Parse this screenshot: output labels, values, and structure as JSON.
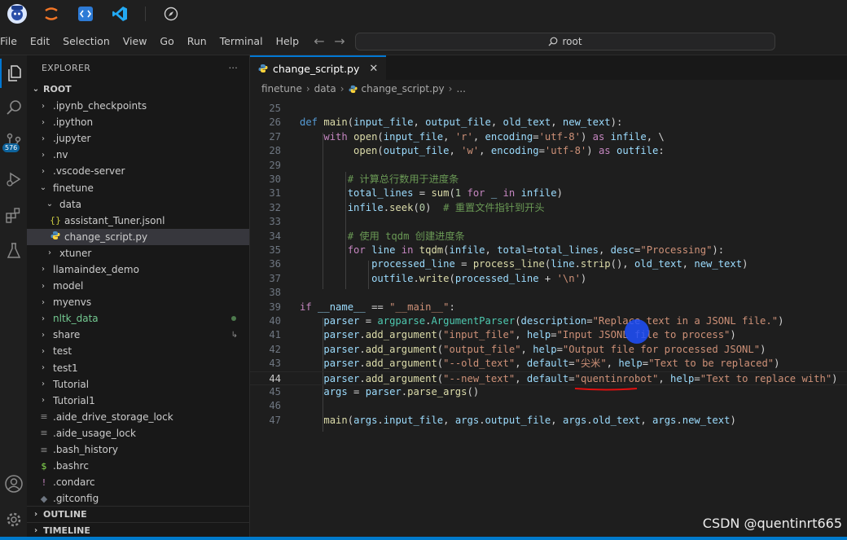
{
  "top_strip": {
    "icons": [
      "pensive-ai-avatar-icon",
      "jupyter-icon",
      "vscode-remote-icon",
      "vscode-icon",
      "compass-icon"
    ]
  },
  "menubar": {
    "items": [
      "File",
      "Edit",
      "Selection",
      "View",
      "Go",
      "Run",
      "Terminal",
      "Help"
    ],
    "search_text": "root"
  },
  "activitybar": {
    "source_control_badge": "576"
  },
  "sidebar": {
    "title": "EXPLORER",
    "more": "···",
    "root_label": "ROOT",
    "tree": [
      {
        "label": ".ipynb_checkpoints",
        "depth": 1,
        "type": "folder",
        "expanded": false
      },
      {
        "label": ".ipython",
        "depth": 1,
        "type": "folder",
        "expanded": false
      },
      {
        "label": ".jupyter",
        "depth": 1,
        "type": "folder",
        "expanded": false
      },
      {
        "label": ".nv",
        "depth": 1,
        "type": "folder",
        "expanded": false
      },
      {
        "label": ".vscode-server",
        "depth": 1,
        "type": "folder",
        "expanded": false
      },
      {
        "label": "finetune",
        "depth": 1,
        "type": "folder",
        "expanded": true
      },
      {
        "label": "data",
        "depth": 2,
        "type": "folder",
        "expanded": true
      },
      {
        "label": "assistant_Tuner.jsonl",
        "depth": 3,
        "type": "json"
      },
      {
        "label": "change_script.py",
        "depth": 3,
        "type": "python",
        "selected": true
      },
      {
        "label": "xtuner",
        "depth": 2,
        "type": "folder",
        "expanded": false
      },
      {
        "label": "llamaindex_demo",
        "depth": 1,
        "type": "folder",
        "expanded": false
      },
      {
        "label": "model",
        "depth": 1,
        "type": "folder",
        "expanded": false
      },
      {
        "label": "myenvs",
        "depth": 1,
        "type": "folder",
        "expanded": false
      },
      {
        "label": "nltk_data",
        "depth": 1,
        "type": "folder",
        "expanded": false,
        "modified": true
      },
      {
        "label": "share",
        "depth": 1,
        "type": "folder",
        "expanded": false,
        "link": true
      },
      {
        "label": "test",
        "depth": 1,
        "type": "folder",
        "expanded": false
      },
      {
        "label": "test1",
        "depth": 1,
        "type": "folder",
        "expanded": false
      },
      {
        "label": "Tutorial",
        "depth": 1,
        "type": "folder",
        "expanded": false
      },
      {
        "label": "Tutorial1",
        "depth": 1,
        "type": "folder",
        "expanded": false
      },
      {
        "label": ".aide_drive_storage_lock",
        "depth": 1,
        "type": "file"
      },
      {
        "label": ".aide_usage_lock",
        "depth": 1,
        "type": "file"
      },
      {
        "label": ".bash_history",
        "depth": 1,
        "type": "file"
      },
      {
        "label": ".bashrc",
        "depth": 1,
        "type": "shell"
      },
      {
        "label": ".condarc",
        "depth": 1,
        "type": "excl"
      },
      {
        "label": ".gitconfig",
        "depth": 1,
        "type": "git"
      }
    ],
    "outline_label": "OUTLINE",
    "timeline_label": "TIMELINE"
  },
  "editor": {
    "tab_label": "change_script.py",
    "tab_close": "✕",
    "breadcrumb": [
      "finetune",
      "data",
      "change_script.py",
      "..."
    ],
    "current_line": 44,
    "lines": [
      {
        "n": "25",
        "html": ""
      },
      {
        "n": "26",
        "html": "<span class='kw'>def</span> <span class='fn'>main</span>(<span class='var'>input_file</span>, <span class='var'>output_file</span>, <span class='var'>old_text</span>, <span class='var'>new_text</span>):"
      },
      {
        "n": "27",
        "html": "    <span class='kw2'>with</span> <span class='fn'>open</span>(<span class='var'>input_file</span>, <span class='str'>'r'</span>, <span class='var'>encoding</span>=<span class='str'>'utf-8'</span>) <span class='kw2'>as</span> <span class='var'>infile</span>, \\"
      },
      {
        "n": "28",
        "html": "         <span class='fn'>open</span>(<span class='var'>output_file</span>, <span class='str'>'w'</span>, <span class='var'>encoding</span>=<span class='str'>'utf-8'</span>) <span class='kw2'>as</span> <span class='var'>outfile</span>:"
      },
      {
        "n": "29",
        "html": ""
      },
      {
        "n": "30",
        "html": "        <span class='cm'># 计算总行数用于进度条</span>"
      },
      {
        "n": "31",
        "html": "        <span class='var'>total_lines</span> = <span class='fn'>sum</span>(<span class='num'>1</span> <span class='kw2'>for</span> <span class='var'>_</span> <span class='kw2'>in</span> <span class='var'>infile</span>)"
      },
      {
        "n": "32",
        "html": "        <span class='var'>infile</span>.<span class='fn'>seek</span>(<span class='num'>0</span>)  <span class='cm'># 重置文件指针到开头</span>"
      },
      {
        "n": "33",
        "html": ""
      },
      {
        "n": "34",
        "html": "        <span class='cm'># 使用 tqdm 创建进度条</span>"
      },
      {
        "n": "35",
        "html": "        <span class='kw2'>for</span> <span class='var'>line</span> <span class='kw2'>in</span> <span class='fn'>tqdm</span>(<span class='var'>infile</span>, <span class='var'>total</span>=<span class='var'>total_lines</span>, <span class='var'>desc</span>=<span class='str'>\"Processing\"</span>):"
      },
      {
        "n": "36",
        "html": "            <span class='var'>processed_line</span> = <span class='fn'>process_line</span>(<span class='var'>line</span>.<span class='fn'>strip</span>(), <span class='var'>old_text</span>, <span class='var'>new_text</span>)"
      },
      {
        "n": "37",
        "html": "            <span class='var'>outfile</span>.<span class='fn'>write</span>(<span class='var'>processed_line</span> + <span class='str'>'\\n'</span>)"
      },
      {
        "n": "38",
        "html": ""
      },
      {
        "n": "39",
        "html": "<span class='kw2'>if</span> <span class='var'>__name__</span> == <span class='str'>\"__main__\"</span>:"
      },
      {
        "n": "40",
        "html": "    <span class='var'>parser</span> = <span class='cls'>argparse</span>.<span class='cls'>ArgumentParser</span>(<span class='var'>description</span>=<span class='str'>\"Replace text in a JSONL file.\"</span>)"
      },
      {
        "n": "41",
        "html": "    <span class='var'>parser</span>.<span class='fn'>add_argument</span>(<span class='str'>\"input_file\"</span>, <span class='var'>help</span>=<span class='str'>\"Input JSONL file to process\"</span>)"
      },
      {
        "n": "42",
        "html": "    <span class='var'>parser</span>.<span class='fn'>add_argument</span>(<span class='str'>\"output_file\"</span>, <span class='var'>help</span>=<span class='str'>\"Output file for processed JSONL\"</span>)"
      },
      {
        "n": "43",
        "html": "    <span class='var'>parser</span>.<span class='fn'>add_argument</span>(<span class='str'>\"--old_text\"</span>, <span class='var'>default</span>=<span class='str'>\"尖米\"</span>, <span class='var'>help</span>=<span class='str'>\"Text to be replaced\"</span>)"
      },
      {
        "n": "44",
        "html": "    <span class='var'>parser</span>.<span class='fn'>add_argument</span>(<span class='str'>\"--new_text\"</span>, <span class='var'>default</span>=<span class='str'>\"quentinrobot\"</span>, <span class='var'>help</span>=<span class='str'>\"Text to replace with\"</span>)"
      },
      {
        "n": "45",
        "html": "    <span class='var'>args</span> = <span class='var'>parser</span>.<span class='fn'>parse_args</span>()"
      },
      {
        "n": "46",
        "html": ""
      },
      {
        "n": "47",
        "html": "    <span class='fn'>main</span>(<span class='var'>args</span>.<span class='var'>input_file</span>, <span class='var'>args</span>.<span class='var'>output_file</span>, <span class='var'>args</span>.<span class='var'>old_text</span>, <span class='var'>args</span>.<span class='var'>new_text</span>)"
      }
    ]
  },
  "watermark": "CSDN @quentinrt665",
  "colors": {
    "accent": "#0078d4",
    "status_bar": "#007acc",
    "cursor_highlight": "#1e50ff",
    "annotation_red": "#e01010"
  }
}
